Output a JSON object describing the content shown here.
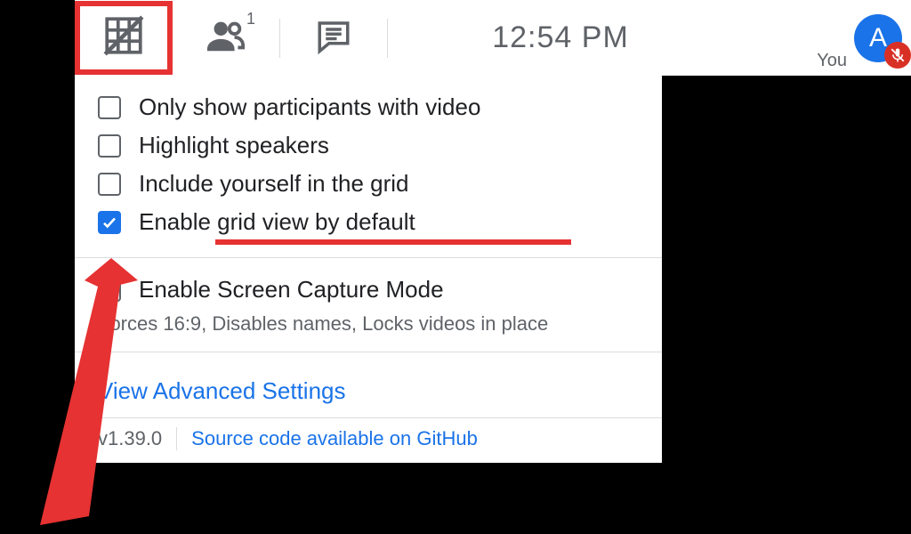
{
  "topbar": {
    "clock": "12:54 PM",
    "you_label": "You",
    "avatar_initial": "A",
    "people_count": "1"
  },
  "options": [
    {
      "label": "Only show participants with video",
      "checked": false
    },
    {
      "label": "Highlight speakers",
      "checked": false
    },
    {
      "label": "Include yourself in the grid",
      "checked": false
    },
    {
      "label": "Enable grid view by default",
      "checked": true
    }
  ],
  "screen_capture": {
    "label": "Enable Screen Capture Mode",
    "hint": "Forces 16:9, Disables names, Locks videos in place",
    "checked": false
  },
  "advanced_link": "View Advanced Settings",
  "footer": {
    "version": "v1.39.0",
    "github_link": "Source code available on GitHub"
  }
}
